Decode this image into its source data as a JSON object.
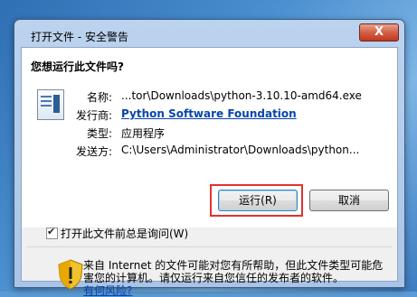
{
  "window": {
    "title": "打开文件 - 安全警告",
    "close_label": "X"
  },
  "dialog": {
    "heading": "您想运行此文件吗?",
    "properties": [
      {
        "label": "名称:",
        "value": "...tor\\Downloads\\python-3.10.10-amd64.exe"
      },
      {
        "label": "发行商:",
        "value": "Python Software Foundation"
      },
      {
        "label": "类型:",
        "value": "应用程序"
      },
      {
        "label": "发送方:",
        "value": "C:\\Users\\Administrator\\Downloads\\python..."
      }
    ],
    "run_button": "运行(R)",
    "cancel_button": "取消",
    "checkbox": {
      "label": "打开此文件前总是询问(W)",
      "checked": true
    },
    "warning_text": "来自 Internet 的文件可能对您有所帮助，但此文件类型可能危害您的计算机。请仅运行来自您信任的发布者的软件。",
    "risk_link": "有何风险?"
  },
  "colors": {
    "highlight": "#e0332f",
    "link": "#0645ad"
  }
}
